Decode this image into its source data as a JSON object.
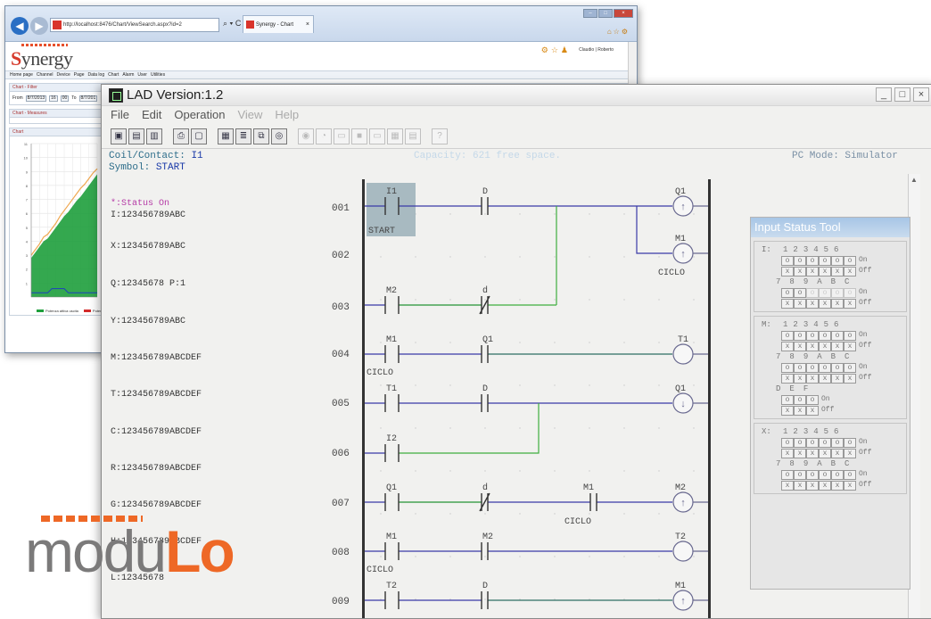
{
  "browser": {
    "address": "http://localhost:8476/Chart/ViewSearch.aspx?id=2",
    "address_tools": "⌕ ▾ C",
    "tab_title": "Synergy - Chart",
    "logo": "ynergy",
    "logo_initial": "S",
    "user": "Claudio | Roberto",
    "menu": [
      "Home page",
      "Channel",
      "Device",
      "Page",
      "Data log",
      "Chart",
      "Alarm",
      "User",
      "Utilities"
    ],
    "panels": {
      "filter": "Chart - Filter",
      "measures": "Chart - Measures",
      "chart": "Chart"
    },
    "filter": {
      "from_label": "From",
      "from_date": "8/7/2013",
      "from_h": "16",
      "from_m": "00",
      "to_label": "To",
      "to_date": "8/7/201"
    },
    "chart_legend": [
      "Potenza attiva uscita",
      "Potenza"
    ],
    "colors": {
      "series_area": "#1e9f3c",
      "series_line": "#f0a850",
      "series_low": "#1c3fbf"
    }
  },
  "chart_data": {
    "type": "area",
    "x": [
      0,
      1,
      2,
      3,
      4,
      5,
      6,
      7,
      8,
      9,
      10,
      11,
      12,
      13,
      14,
      15,
      16
    ],
    "series": [
      {
        "values": [
          2.8,
          3.2,
          3.6,
          4.0,
          4.2,
          4.6,
          5.0,
          5.4,
          5.8,
          6.1,
          6.5,
          6.9,
          7.2,
          7.6,
          8.0,
          8.4,
          8.8
        ]
      },
      {
        "values": [
          3.0,
          3.4,
          3.8,
          4.3,
          4.5,
          4.9,
          5.3,
          5.8,
          6.2,
          6.6,
          7.0,
          7.4,
          7.8,
          8.1,
          8.5,
          8.9,
          9.2
        ]
      },
      {
        "values": [
          0.3,
          0.3,
          0.3,
          0.3,
          0.3,
          0.6,
          0.6,
          0.6,
          0.6,
          0.3,
          0.3,
          0.3,
          0.3,
          0.3,
          0.3,
          0.3,
          0.3
        ]
      }
    ],
    "ylim": [
      0,
      11
    ],
    "yticks": [
      "1",
      "2",
      "3",
      "4",
      "5",
      "6",
      "7",
      "8",
      "9",
      "10",
      "11"
    ],
    "grid": true
  },
  "lad": {
    "title": "LAD Version:1.2",
    "menu": [
      "File",
      "Edit",
      "Operation",
      "View",
      "Help"
    ],
    "toolbar_icons": [
      "new-icon",
      "open-icon",
      "save-icon",
      "print-icon",
      "preview-icon",
      "monitor-icon",
      "list-icon",
      "compare-icon",
      "view-icon",
      "run-icon",
      "step-icon",
      "rw-icon",
      "stop-icon",
      "quit-icon",
      "table-icon",
      "grid-icon",
      "help-icon"
    ],
    "info": {
      "coil_label": "Coil/Contact:",
      "coil_value": "I1",
      "symbol_label": "Symbol:",
      "symbol_value": "START",
      "capacity": "Capacity: 621 free space.",
      "pc_mode": "PC Mode: Simulator"
    },
    "operands": [
      "*:Status On",
      "I:123456789ABC",
      "X:123456789ABC",
      "Q:12345678 P:1",
      "Y:123456789ABC",
      "M:123456789ABCDEF",
      "T:123456789ABCDEF",
      "C:123456789ABCDEF",
      "R:123456789ABCDEF",
      "G:123456789ABCDEF",
      "H:123456789ABCDEF",
      "L:12345678"
    ],
    "rungs": [
      "001",
      "002",
      "003",
      "004",
      "005",
      "006",
      "007",
      "008",
      "009"
    ],
    "labels": {
      "i1": "I1",
      "start": "START",
      "d": "D",
      "q1": "Q1",
      "m1": "M1",
      "ciclo": "CICLO",
      "m2": "M2",
      "d_low": "d",
      "t1": "T1",
      "i2": "I2",
      "t2": "T2"
    },
    "colors": {
      "blue_wire": "#3a3aa8",
      "green_wire": "#3fae3f",
      "selection": "#9bb0b8"
    }
  },
  "status_tool": {
    "title": "Input Status Tool",
    "on": "On",
    "off": "Off",
    "on_glyph": "o",
    "off_glyph": "x",
    "i_label": "I:",
    "m_label": "M:",
    "x_label": "X:",
    "nums1": [
      "1",
      "2",
      "3",
      "4",
      "5",
      "6"
    ],
    "nums2": [
      "7",
      "8",
      "9",
      "A",
      "B",
      "C"
    ],
    "nums3": [
      "D",
      "E",
      "F"
    ]
  },
  "brand": {
    "mod": "modu",
    "lo": "Lo"
  }
}
